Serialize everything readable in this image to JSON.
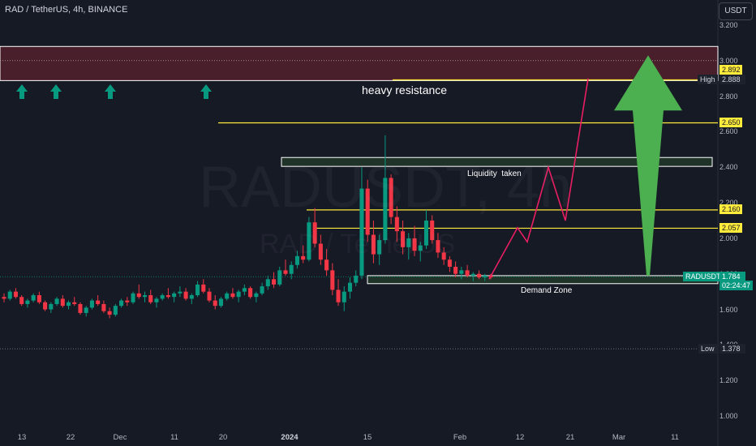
{
  "header": {
    "symbol_line": "RAD / TetherUS, 4h, BINANCE",
    "currency": "USDT"
  },
  "watermark": {
    "ticker": "RADUSDT, 4h",
    "pair": "RAD / TetherUS"
  },
  "chart_data": {
    "type": "candlestick",
    "x_ticks": [
      "13",
      "22",
      "Dec",
      "11",
      "20",
      "2024",
      "15",
      "Feb",
      "12",
      "21",
      "Mar",
      "11"
    ],
    "x_tick_bold": [
      "2024"
    ],
    "y_ticks": [
      "3.200",
      "3.000",
      "2.800",
      "2.600",
      "2.400",
      "2.200",
      "2.000",
      "1.800",
      "1.600",
      "1.400",
      "1.200",
      "1.000"
    ],
    "ylim": [
      1.0,
      3.2
    ],
    "price_levels": [
      {
        "label": "High",
        "value": "2.888"
      },
      {
        "label": "Low",
        "value": "1.378"
      }
    ],
    "horizontal_lines": [
      "2.892",
      "2.650",
      "2.160",
      "2.057"
    ],
    "last_price": {
      "symbol": "RADUSDT",
      "value": "1.784",
      "countdown": "02:24:47"
    },
    "zones": [
      {
        "name": "heavy resistance zone",
        "from": 2.888,
        "to": 3.08
      },
      {
        "name": "Liquidity taken",
        "from": 2.405,
        "to": 2.455
      },
      {
        "name": "Demand Zone",
        "from": 1.745,
        "to": 1.79
      }
    ],
    "annotations": [
      "heavy resistance",
      "Liquidity  taken",
      "Demand Zone"
    ],
    "projection_path": [
      1.77,
      2.06,
      1.98,
      2.4,
      2.1,
      2.9
    ],
    "candles": [
      [
        1.67,
        1.69,
        1.64,
        1.66
      ],
      [
        1.66,
        1.71,
        1.65,
        1.7
      ],
      [
        1.7,
        1.72,
        1.66,
        1.67
      ],
      [
        1.67,
        1.68,
        1.62,
        1.63
      ],
      [
        1.63,
        1.66,
        1.61,
        1.65
      ],
      [
        1.65,
        1.69,
        1.64,
        1.68
      ],
      [
        1.68,
        1.7,
        1.63,
        1.64
      ],
      [
        1.64,
        1.65,
        1.59,
        1.6
      ],
      [
        1.6,
        1.64,
        1.58,
        1.63
      ],
      [
        1.63,
        1.67,
        1.62,
        1.66
      ],
      [
        1.66,
        1.68,
        1.61,
        1.62
      ],
      [
        1.62,
        1.65,
        1.6,
        1.64
      ],
      [
        1.64,
        1.67,
        1.62,
        1.63
      ],
      [
        1.63,
        1.64,
        1.57,
        1.58
      ],
      [
        1.58,
        1.62,
        1.56,
        1.61
      ],
      [
        1.61,
        1.66,
        1.6,
        1.65
      ],
      [
        1.65,
        1.68,
        1.62,
        1.63
      ],
      [
        1.63,
        1.65,
        1.58,
        1.59
      ],
      [
        1.59,
        1.61,
        1.55,
        1.57
      ],
      [
        1.57,
        1.63,
        1.56,
        1.62
      ],
      [
        1.62,
        1.66,
        1.61,
        1.65
      ],
      [
        1.65,
        1.67,
        1.62,
        1.64
      ],
      [
        1.64,
        1.7,
        1.63,
        1.69
      ],
      [
        1.69,
        1.74,
        1.66,
        1.67
      ],
      [
        1.67,
        1.7,
        1.64,
        1.68
      ],
      [
        1.68,
        1.71,
        1.63,
        1.64
      ],
      [
        1.64,
        1.67,
        1.61,
        1.66
      ],
      [
        1.66,
        1.69,
        1.65,
        1.68
      ],
      [
        1.68,
        1.72,
        1.66,
        1.67
      ],
      [
        1.67,
        1.7,
        1.64,
        1.69
      ],
      [
        1.69,
        1.73,
        1.67,
        1.7
      ],
      [
        1.7,
        1.72,
        1.65,
        1.66
      ],
      [
        1.66,
        1.69,
        1.63,
        1.68
      ],
      [
        1.68,
        1.76,
        1.67,
        1.74
      ],
      [
        1.74,
        1.77,
        1.69,
        1.7
      ],
      [
        1.7,
        1.72,
        1.64,
        1.65
      ],
      [
        1.65,
        1.68,
        1.6,
        1.62
      ],
      [
        1.62,
        1.67,
        1.61,
        1.66
      ],
      [
        1.66,
        1.7,
        1.65,
        1.69
      ],
      [
        1.69,
        1.72,
        1.66,
        1.67
      ],
      [
        1.67,
        1.71,
        1.64,
        1.7
      ],
      [
        1.7,
        1.74,
        1.68,
        1.72
      ],
      [
        1.72,
        1.73,
        1.66,
        1.67
      ],
      [
        1.67,
        1.7,
        1.64,
        1.69
      ],
      [
        1.69,
        1.75,
        1.68,
        1.73
      ],
      [
        1.73,
        1.79,
        1.71,
        1.77
      ],
      [
        1.77,
        1.81,
        1.72,
        1.74
      ],
      [
        1.74,
        1.84,
        1.73,
        1.82
      ],
      [
        1.82,
        1.88,
        1.79,
        1.8
      ],
      [
        1.8,
        1.87,
        1.77,
        1.85
      ],
      [
        1.85,
        1.93,
        1.83,
        1.9
      ],
      [
        1.9,
        1.96,
        1.86,
        1.88
      ],
      [
        1.88,
        2.12,
        1.87,
        2.09
      ],
      [
        2.09,
        2.17,
        1.95,
        1.97
      ],
      [
        1.97,
        2.02,
        1.85,
        1.88
      ],
      [
        1.88,
        1.94,
        1.79,
        1.82
      ],
      [
        1.82,
        1.86,
        1.68,
        1.71
      ],
      [
        1.71,
        1.77,
        1.62,
        1.64
      ],
      [
        1.64,
        1.73,
        1.59,
        1.7
      ],
      [
        1.7,
        1.78,
        1.66,
        1.75
      ],
      [
        1.75,
        1.82,
        1.73,
        1.79
      ],
      [
        1.79,
        2.4,
        1.77,
        2.28
      ],
      [
        2.28,
        2.33,
        1.98,
        2.02
      ],
      [
        2.02,
        2.1,
        1.86,
        1.91
      ],
      [
        1.91,
        2.02,
        1.85,
        1.99
      ],
      [
        1.99,
        2.58,
        1.97,
        2.34
      ],
      [
        2.34,
        2.36,
        2.08,
        2.12
      ],
      [
        2.12,
        2.18,
        1.98,
        2.04
      ],
      [
        2.04,
        2.1,
        1.91,
        1.95
      ],
      [
        1.95,
        2.03,
        1.88,
        2.0
      ],
      [
        2.0,
        2.07,
        1.9,
        1.93
      ],
      [
        1.93,
        1.98,
        1.87,
        1.96
      ],
      [
        1.96,
        2.16,
        1.94,
        2.1
      ],
      [
        2.1,
        2.13,
        1.97,
        1.99
      ],
      [
        1.99,
        2.03,
        1.89,
        1.92
      ],
      [
        1.92,
        1.95,
        1.85,
        1.88
      ],
      [
        1.88,
        1.9,
        1.81,
        1.84
      ],
      [
        1.84,
        1.87,
        1.78,
        1.8
      ],
      [
        1.8,
        1.84,
        1.77,
        1.82
      ],
      [
        1.82,
        1.85,
        1.78,
        1.79
      ],
      [
        1.79,
        1.81,
        1.76,
        1.8
      ],
      [
        1.8,
        1.82,
        1.77,
        1.78
      ],
      [
        1.78,
        1.8,
        1.76,
        1.79
      ],
      [
        1.79,
        1.8,
        1.77,
        1.78
      ]
    ]
  }
}
